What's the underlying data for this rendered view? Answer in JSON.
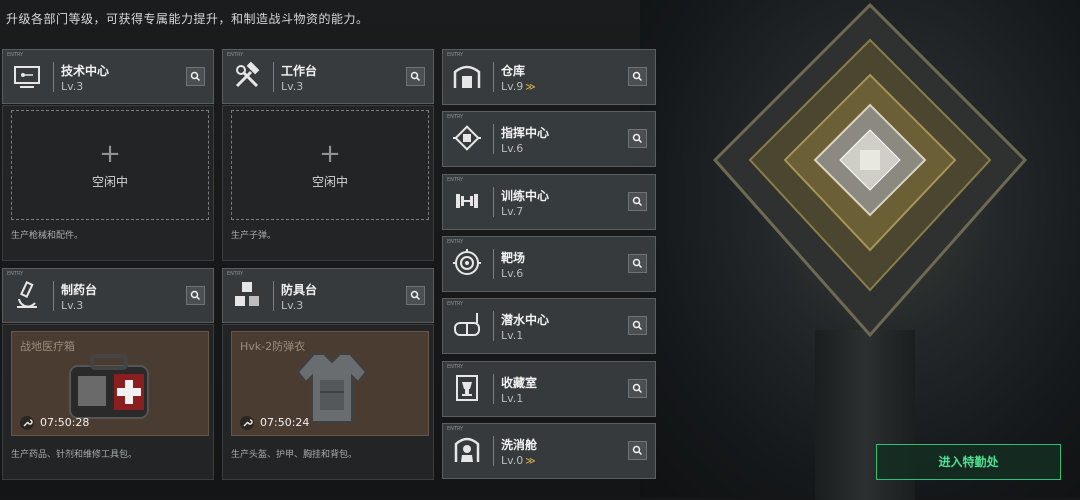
{
  "header": {
    "subtitle": "升级各部门等级，可获得专属能力提升，和制造战斗物资的能力。"
  },
  "left_cards": [
    {
      "name": "技术中心",
      "level": "Lv.3",
      "icon": "chip-board-icon"
    },
    {
      "name": "工作台",
      "level": "Lv.3",
      "icon": "hammer-wrench-icon"
    },
    {
      "name": "制药台",
      "level": "Lv.3",
      "icon": "microscope-icon"
    },
    {
      "name": "防具台",
      "level": "Lv.3",
      "icon": "blocks-icon"
    }
  ],
  "idle_panels": [
    {
      "idle_label": "空闲中",
      "description": "生产枪械和配件。"
    },
    {
      "idle_label": "空闲中",
      "description": "生产子弹。"
    }
  ],
  "craft_panels": [
    {
      "item": "战地医疗箱",
      "timer": "07:50:28",
      "description": "生产药品、针剂和维修工具包。"
    },
    {
      "item": "Hvk-2防弹衣",
      "timer": "07:50:24",
      "description": "生产头盔、护甲、胸挂和背包。"
    }
  ],
  "right_cards": [
    {
      "name": "仓库",
      "level": "Lv.9",
      "upgrade": "≫",
      "icon": "warehouse-icon"
    },
    {
      "name": "指挥中心",
      "level": "Lv.6",
      "upgrade": "",
      "icon": "command-chip-icon"
    },
    {
      "name": "训练中心",
      "level": "Lv.7",
      "upgrade": "",
      "icon": "dumbbell-icon"
    },
    {
      "name": "靶场",
      "level": "Lv.6",
      "upgrade": "",
      "icon": "target-icon"
    },
    {
      "name": "潜水中心",
      "level": "Lv.1",
      "upgrade": "",
      "icon": "diving-mask-icon"
    },
    {
      "name": "收藏室",
      "level": "Lv.1",
      "upgrade": "",
      "icon": "trophy-case-icon"
    },
    {
      "name": "洗消舱",
      "level": "Lv.0",
      "upgrade": "≫",
      "icon": "decon-chamber-icon"
    }
  ],
  "enter_button": {
    "label": "进入特勤处"
  },
  "colors": {
    "accent_green": "#4ee08e",
    "upgrade_gold": "#e6b84a",
    "card_bg": "#3a3e40"
  }
}
